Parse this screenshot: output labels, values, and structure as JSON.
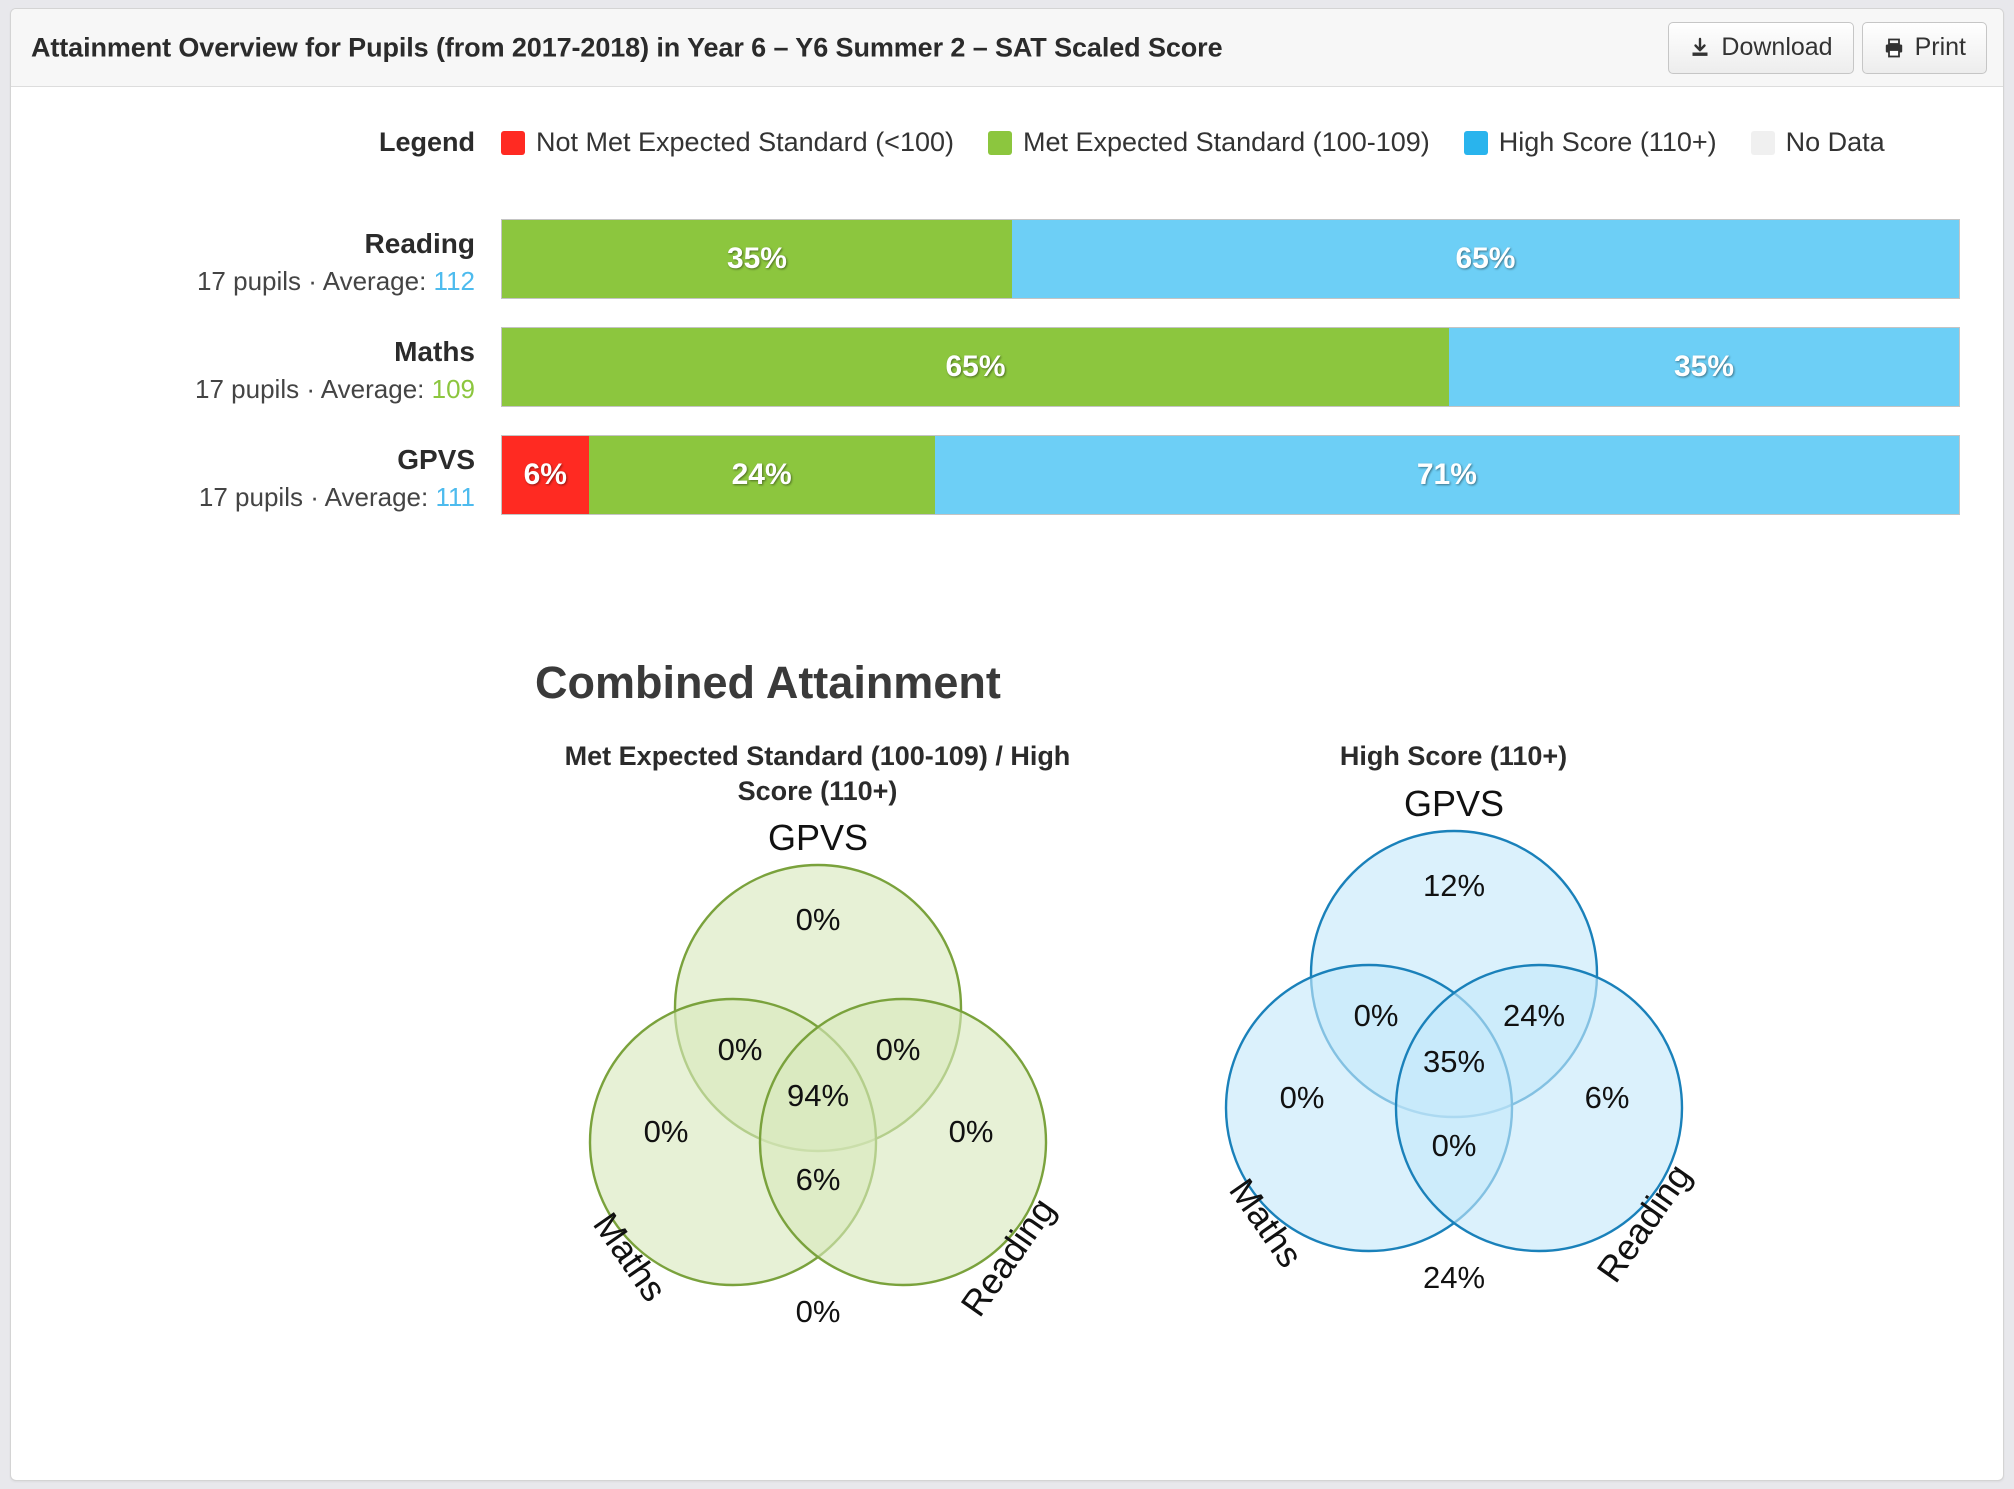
{
  "header": {
    "title": "Attainment Overview for Pupils (from 2017-2018) in Year 6 – Y6 Summer 2 – SAT Scaled Score",
    "download_label": "Download",
    "print_label": "Print"
  },
  "legend": {
    "label": "Legend",
    "items": [
      {
        "label": "Not Met Expected Standard (<100)",
        "color": "#ff2a22"
      },
      {
        "label": "Met Expected Standard (100-109)",
        "color": "#8cc63e"
      },
      {
        "label": "High Score (110+)",
        "color": "#29b4ed"
      },
      {
        "label": "No Data",
        "color": "#f0f0f0"
      }
    ]
  },
  "colors": {
    "not_met": "#ff2a22",
    "met": "#8cc63e",
    "high": "#6dcff6",
    "no_data": "#f0f0f0",
    "avg_high": "#4dbbee",
    "avg_met": "#8cc63e",
    "venn_green_stroke": "#7aa23c",
    "venn_green_fill": "#d8e9bd",
    "venn_blue_stroke": "#1a81ba",
    "venn_blue_fill": "#c5e8fa"
  },
  "chart_data": {
    "type": "bar",
    "title": "Attainment Overview for Pupils (from 2017-2018) in Year 6 – Y6 Summer 2 – SAT Scaled Score",
    "stacked": true,
    "orientation": "horizontal",
    "categories": [
      "Reading",
      "Maths",
      "GPVS"
    ],
    "series": [
      {
        "name": "Not Met Expected Standard (<100)",
        "color": "#ff2a22",
        "values": [
          0,
          0,
          6
        ]
      },
      {
        "name": "Met Expected Standard (100-109)",
        "color": "#8cc63e",
        "values": [
          35,
          65,
          24
        ]
      },
      {
        "name": "High Score (110+)",
        "color": "#6dcff6",
        "values": [
          65,
          35,
          71
        ]
      }
    ],
    "xlabel": "",
    "ylabel": "",
    "xlim": [
      0,
      100
    ]
  },
  "subjects": [
    {
      "name": "Reading",
      "pupils_text": "17 pupils · Average: ",
      "average": "112",
      "average_color": "#4dbbee",
      "segments": [
        {
          "label": "35%",
          "value": 35,
          "color": "#8cc63e",
          "type": "met"
        },
        {
          "label": "65%",
          "value": 65,
          "color": "#6dcff6",
          "type": "high"
        }
      ]
    },
    {
      "name": "Maths",
      "pupils_text": "17 pupils · Average: ",
      "average": "109",
      "average_color": "#8cc63e",
      "segments": [
        {
          "label": "65%",
          "value": 65,
          "color": "#8cc63e",
          "type": "met"
        },
        {
          "label": "35%",
          "value": 35,
          "color": "#6dcff6",
          "type": "high"
        }
      ]
    },
    {
      "name": "GPVS",
      "pupils_text": "17 pupils · Average: ",
      "average": "111",
      "average_color": "#4dbbee",
      "segments": [
        {
          "label": "6%",
          "value": 6,
          "color": "#ff2a22",
          "type": "not_met"
        },
        {
          "label": "24%",
          "value": 24,
          "color": "#8cc63e",
          "type": "met"
        },
        {
          "label": "71%",
          "value": 71,
          "color": "#6dcff6",
          "type": "high"
        }
      ]
    }
  ],
  "combined": {
    "heading": "Combined Attainment",
    "venns": [
      {
        "id": "met-or-high",
        "caption": "Met Expected Standard (100-109) / High Score (110+)",
        "top_label": "GPVS",
        "left_label": "Maths",
        "right_label": "Reading",
        "regions": {
          "top_only": "0%",
          "top_left": "0%",
          "top_right": "0%",
          "center": "94%",
          "left_only": "0%",
          "right_only": "0%",
          "bottom": "6%",
          "outside": "0%"
        }
      },
      {
        "id": "high-score",
        "caption": "High Score (110+)",
        "top_label": "GPVS",
        "left_label": "Maths",
        "right_label": "Reading",
        "regions": {
          "top_only": "12%",
          "top_left": "0%",
          "top_right": "24%",
          "center": "35%",
          "left_only": "0%",
          "right_only": "6%",
          "bottom": "0%",
          "outside": "24%"
        }
      }
    ]
  }
}
